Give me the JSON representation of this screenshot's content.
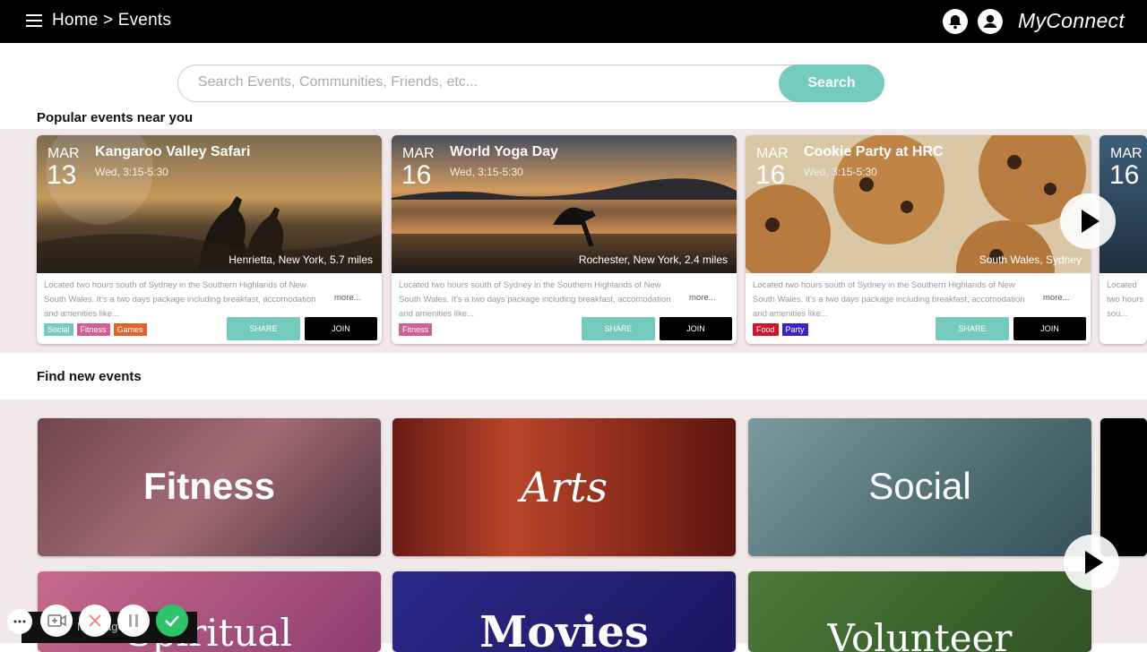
{
  "header": {
    "crumb": "Home > Events",
    "brand": "MyConnect"
  },
  "search": {
    "placeholder": "Search Events, Communities, Friends, etc...",
    "button": "Search"
  },
  "popular_title": "Popular events near you",
  "find_title": "Find new events",
  "events": [
    {
      "month": "MAR",
      "day": "13",
      "title": "Kangaroo Valley Safari",
      "time": "Wed, 3:15-5:30",
      "location": "Henrietta, New York, 5.7 miles",
      "desc": "Located two hours south of Sydney in the Southern Highlands of New South Wales. It's a two days package including breakfast, accomodation and amenities like...",
      "more": "more...",
      "tags": [
        {
          "label": "Social",
          "color": "#74cbbd"
        },
        {
          "label": "Fitness",
          "color": "#d0608e"
        },
        {
          "label": "Games",
          "color": "#e0622a"
        }
      ],
      "share": "SHARE",
      "join": "JOIN"
    },
    {
      "month": "MAR",
      "day": "16",
      "title": "World Yoga Day",
      "time": "Wed, 3:15-5:30",
      "location": "Rochester, New York, 2.4 miles",
      "desc": "Located two hours south of Sydney in the Southern Highlands of New South Wales. It's a two days package including breakfast, accomodation and amenities like...",
      "more": "more...",
      "tags": [
        {
          "label": "Fitness",
          "color": "#d0608e"
        }
      ],
      "share": "SHARE",
      "join": "JOIN"
    },
    {
      "month": "MAR",
      "day": "16",
      "title": "Cookie Party at HRC",
      "time": "Wed, 3:15-5:30",
      "location": "South Wales, Sydney",
      "desc": "Located two hours south of Sydney in the Southern Highlands of New South Wales. It's a two days package including breakfast, accomodation and amenities like...",
      "more": "more...",
      "tags": [
        {
          "label": "Food",
          "color": "#d0142c"
        },
        {
          "label": "Party",
          "color": "#3a22c8"
        }
      ],
      "share": "SHARE",
      "join": "JOIN"
    }
  ],
  "peek": {
    "month": "MAR",
    "day": "16",
    "desc": "Located two hours sou..."
  },
  "categories": [
    {
      "label": "Fitness"
    },
    {
      "label": "Arts"
    },
    {
      "label": "Social"
    },
    {
      "label": "Spiritual"
    },
    {
      "label": "Movies"
    },
    {
      "label": "Volunteer"
    }
  ],
  "call_bar": {
    "message_label": "Message"
  },
  "colors": {
    "accent": "#74cbbd",
    "header": "#000000",
    "band": "#f1e9e9"
  }
}
